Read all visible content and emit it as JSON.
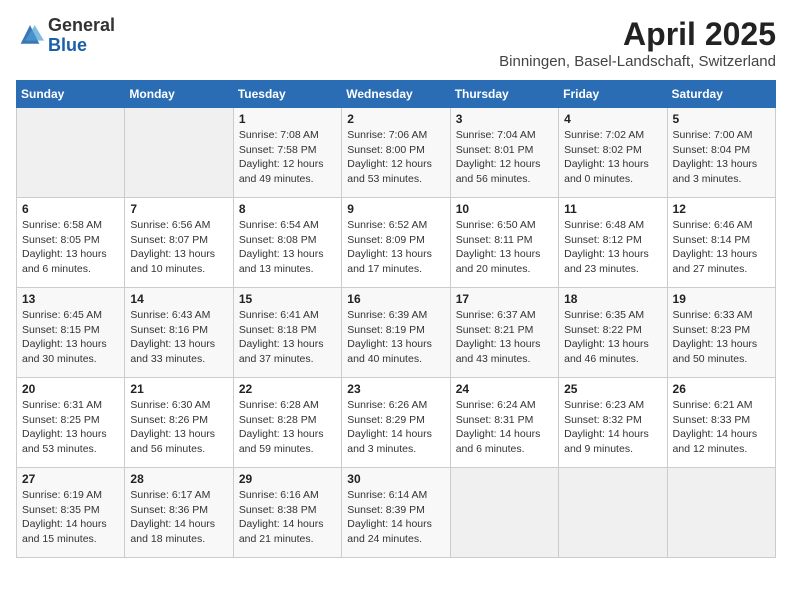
{
  "header": {
    "logo_general": "General",
    "logo_blue": "Blue",
    "month_year": "April 2025",
    "location": "Binningen, Basel-Landschaft, Switzerland"
  },
  "weekdays": [
    "Sunday",
    "Monday",
    "Tuesday",
    "Wednesday",
    "Thursday",
    "Friday",
    "Saturday"
  ],
  "weeks": [
    [
      {
        "day": "",
        "info": ""
      },
      {
        "day": "",
        "info": ""
      },
      {
        "day": "1",
        "info": "Sunrise: 7:08 AM\nSunset: 7:58 PM\nDaylight: 12 hours\nand 49 minutes."
      },
      {
        "day": "2",
        "info": "Sunrise: 7:06 AM\nSunset: 8:00 PM\nDaylight: 12 hours\nand 53 minutes."
      },
      {
        "day": "3",
        "info": "Sunrise: 7:04 AM\nSunset: 8:01 PM\nDaylight: 12 hours\nand 56 minutes."
      },
      {
        "day": "4",
        "info": "Sunrise: 7:02 AM\nSunset: 8:02 PM\nDaylight: 13 hours\nand 0 minutes."
      },
      {
        "day": "5",
        "info": "Sunrise: 7:00 AM\nSunset: 8:04 PM\nDaylight: 13 hours\nand 3 minutes."
      }
    ],
    [
      {
        "day": "6",
        "info": "Sunrise: 6:58 AM\nSunset: 8:05 PM\nDaylight: 13 hours\nand 6 minutes."
      },
      {
        "day": "7",
        "info": "Sunrise: 6:56 AM\nSunset: 8:07 PM\nDaylight: 13 hours\nand 10 minutes."
      },
      {
        "day": "8",
        "info": "Sunrise: 6:54 AM\nSunset: 8:08 PM\nDaylight: 13 hours\nand 13 minutes."
      },
      {
        "day": "9",
        "info": "Sunrise: 6:52 AM\nSunset: 8:09 PM\nDaylight: 13 hours\nand 17 minutes."
      },
      {
        "day": "10",
        "info": "Sunrise: 6:50 AM\nSunset: 8:11 PM\nDaylight: 13 hours\nand 20 minutes."
      },
      {
        "day": "11",
        "info": "Sunrise: 6:48 AM\nSunset: 8:12 PM\nDaylight: 13 hours\nand 23 minutes."
      },
      {
        "day": "12",
        "info": "Sunrise: 6:46 AM\nSunset: 8:14 PM\nDaylight: 13 hours\nand 27 minutes."
      }
    ],
    [
      {
        "day": "13",
        "info": "Sunrise: 6:45 AM\nSunset: 8:15 PM\nDaylight: 13 hours\nand 30 minutes."
      },
      {
        "day": "14",
        "info": "Sunrise: 6:43 AM\nSunset: 8:16 PM\nDaylight: 13 hours\nand 33 minutes."
      },
      {
        "day": "15",
        "info": "Sunrise: 6:41 AM\nSunset: 8:18 PM\nDaylight: 13 hours\nand 37 minutes."
      },
      {
        "day": "16",
        "info": "Sunrise: 6:39 AM\nSunset: 8:19 PM\nDaylight: 13 hours\nand 40 minutes."
      },
      {
        "day": "17",
        "info": "Sunrise: 6:37 AM\nSunset: 8:21 PM\nDaylight: 13 hours\nand 43 minutes."
      },
      {
        "day": "18",
        "info": "Sunrise: 6:35 AM\nSunset: 8:22 PM\nDaylight: 13 hours\nand 46 minutes."
      },
      {
        "day": "19",
        "info": "Sunrise: 6:33 AM\nSunset: 8:23 PM\nDaylight: 13 hours\nand 50 minutes."
      }
    ],
    [
      {
        "day": "20",
        "info": "Sunrise: 6:31 AM\nSunset: 8:25 PM\nDaylight: 13 hours\nand 53 minutes."
      },
      {
        "day": "21",
        "info": "Sunrise: 6:30 AM\nSunset: 8:26 PM\nDaylight: 13 hours\nand 56 minutes."
      },
      {
        "day": "22",
        "info": "Sunrise: 6:28 AM\nSunset: 8:28 PM\nDaylight: 13 hours\nand 59 minutes."
      },
      {
        "day": "23",
        "info": "Sunrise: 6:26 AM\nSunset: 8:29 PM\nDaylight: 14 hours\nand 3 minutes."
      },
      {
        "day": "24",
        "info": "Sunrise: 6:24 AM\nSunset: 8:31 PM\nDaylight: 14 hours\nand 6 minutes."
      },
      {
        "day": "25",
        "info": "Sunrise: 6:23 AM\nSunset: 8:32 PM\nDaylight: 14 hours\nand 9 minutes."
      },
      {
        "day": "26",
        "info": "Sunrise: 6:21 AM\nSunset: 8:33 PM\nDaylight: 14 hours\nand 12 minutes."
      }
    ],
    [
      {
        "day": "27",
        "info": "Sunrise: 6:19 AM\nSunset: 8:35 PM\nDaylight: 14 hours\nand 15 minutes."
      },
      {
        "day": "28",
        "info": "Sunrise: 6:17 AM\nSunset: 8:36 PM\nDaylight: 14 hours\nand 18 minutes."
      },
      {
        "day": "29",
        "info": "Sunrise: 6:16 AM\nSunset: 8:38 PM\nDaylight: 14 hours\nand 21 minutes."
      },
      {
        "day": "30",
        "info": "Sunrise: 6:14 AM\nSunset: 8:39 PM\nDaylight: 14 hours\nand 24 minutes."
      },
      {
        "day": "",
        "info": ""
      },
      {
        "day": "",
        "info": ""
      },
      {
        "day": "",
        "info": ""
      }
    ]
  ]
}
